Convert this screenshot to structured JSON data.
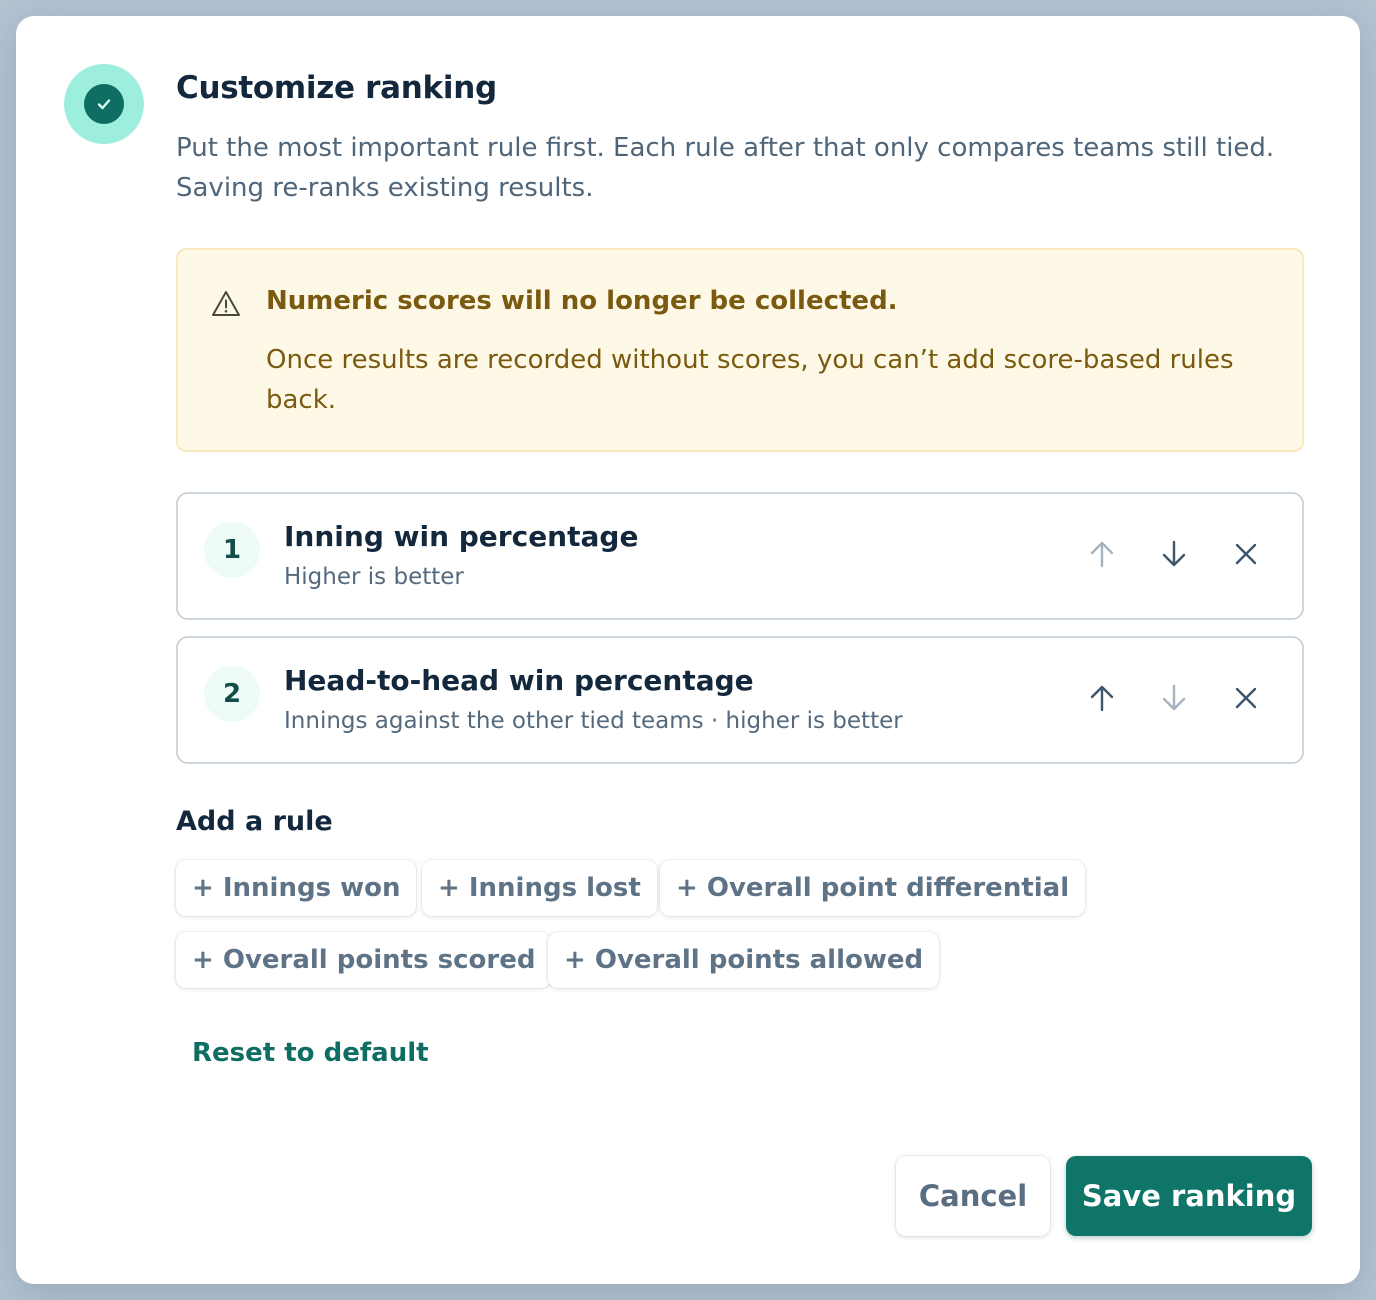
{
  "dialog": {
    "title": "Customize ranking",
    "description": "Put the most important rule first. Each rule after that only compares teams still tied. Saving re-ranks existing results.",
    "header_icon": "check-circle-icon"
  },
  "warning": {
    "icon": "warning-triangle-icon",
    "title": "Numeric scores will no longer be collected.",
    "body": "Once results are recorded without scores, you can’t add score-based rules back."
  },
  "rules": [
    {
      "number": "1",
      "title": "Inning win percentage",
      "subtitle": "Higher is better",
      "move_up_enabled": false,
      "move_down_enabled": true
    },
    {
      "number": "2",
      "title": "Head-to-head win percentage",
      "subtitle": "Innings against the other tied teams · higher is better",
      "move_up_enabled": true,
      "move_down_enabled": false
    }
  ],
  "add_rule": {
    "label": "Add a rule",
    "options": [
      "+ Innings won",
      "+ Innings lost",
      "+ Overall point differential",
      "+ Overall points scored",
      "+ Overall points allowed"
    ]
  },
  "reset_label": "Reset to default",
  "footer": {
    "cancel_label": "Cancel",
    "save_label": "Save ranking"
  },
  "colors": {
    "accent": "#0f7568",
    "icon_bg": "#9eeedd",
    "warning_bg": "#fef9e7",
    "warning_text": "#7a5a10",
    "enabled_icon": "#3d566d",
    "disabled_icon": "#a6b3bf"
  }
}
